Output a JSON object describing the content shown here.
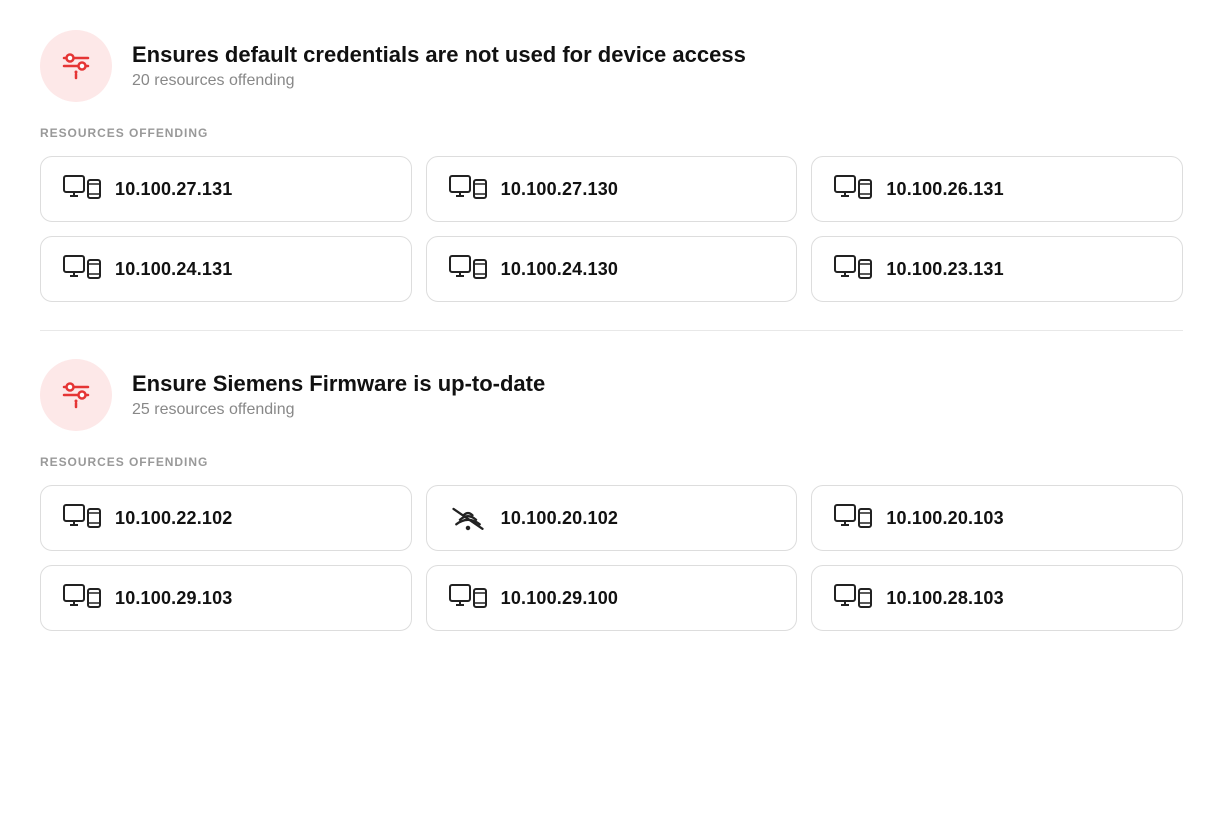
{
  "sections": [
    {
      "id": "section-1",
      "icon": "⚙",
      "title": "Ensures default credentials are not used for device access",
      "subtitle": "20 resources offending",
      "sectionLabel": "RESOURCES OFFENDING",
      "resources": [
        {
          "ip": "10.100.27.131",
          "iconType": "device"
        },
        {
          "ip": "10.100.27.130",
          "iconType": "device"
        },
        {
          "ip": "10.100.26.131",
          "iconType": "device"
        },
        {
          "ip": "10.100.24.131",
          "iconType": "device"
        },
        {
          "ip": "10.100.24.130",
          "iconType": "device"
        },
        {
          "ip": "10.100.23.131",
          "iconType": "device"
        }
      ]
    },
    {
      "id": "section-2",
      "icon": "⚙",
      "title": "Ensure Siemens Firmware is up-to-date",
      "subtitle": "25 resources offending",
      "sectionLabel": "RESOURCES OFFENDING",
      "resources": [
        {
          "ip": "10.100.22.102",
          "iconType": "device"
        },
        {
          "ip": "10.100.20.102",
          "iconType": "device-alt"
        },
        {
          "ip": "10.100.20.103",
          "iconType": "device"
        },
        {
          "ip": "10.100.29.103",
          "iconType": "device"
        },
        {
          "ip": "10.100.29.100",
          "iconType": "device"
        },
        {
          "ip": "10.100.28.103",
          "iconType": "device"
        }
      ]
    }
  ],
  "icons": {
    "policy_icon": "⚙!",
    "device_icon": "🖥"
  }
}
